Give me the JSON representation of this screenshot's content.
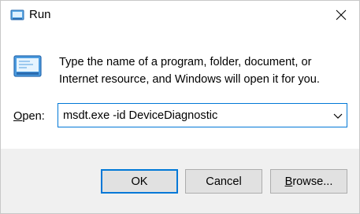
{
  "window": {
    "title": "Run",
    "close_icon": "close-icon"
  },
  "dialog": {
    "description": "Type the name of a program, folder, document, or Internet resource, and Windows will open it for you.",
    "open_label_mnemonic": "O",
    "open_label_rest": "pen:",
    "command_value": "msdt.exe -id DeviceDiagnostic"
  },
  "buttons": {
    "ok": "OK",
    "cancel": "Cancel",
    "browse_mnemonic": "B",
    "browse_rest": "rowse..."
  },
  "colors": {
    "accent": "#0078d7",
    "footer_bg": "#f0f0f0",
    "button_bg": "#e1e1e1"
  }
}
